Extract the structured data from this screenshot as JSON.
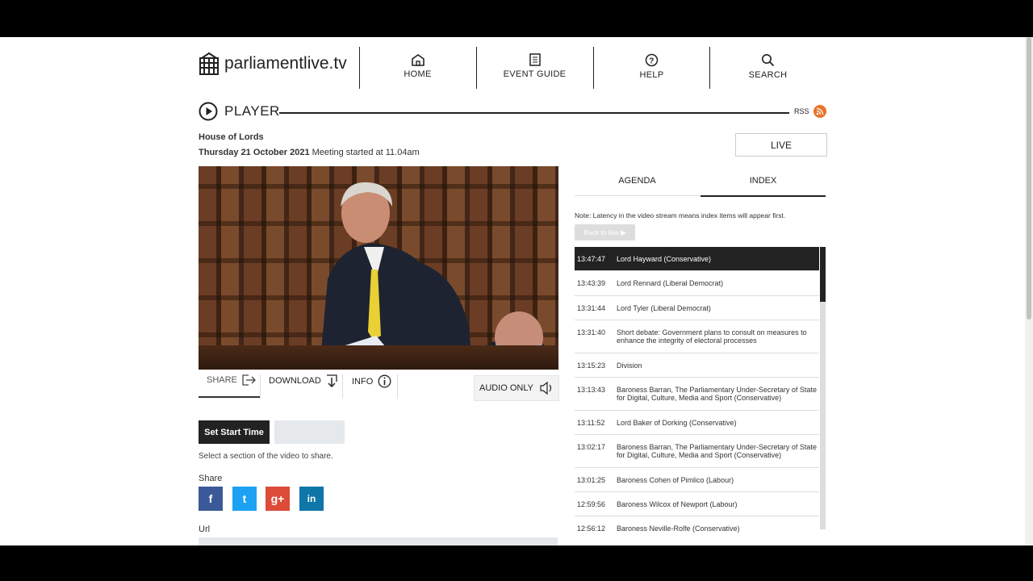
{
  "header": {
    "logo_text": "parliamentlive.tv",
    "nav": [
      {
        "label": "HOME",
        "icon": "home-icon"
      },
      {
        "label": "EVENT GUIDE",
        "icon": "document-icon"
      },
      {
        "label": "HELP",
        "icon": "help-icon"
      },
      {
        "label": "SEARCH",
        "icon": "search-icon"
      }
    ]
  },
  "player": {
    "title": "PLAYER",
    "rss_label": "RSS",
    "house": "House of Lords",
    "date": "Thursday 21 October 2021",
    "meeting_text": " Meeting started at 11.04am",
    "live_label": "LIVE"
  },
  "controls": {
    "share": "SHARE",
    "download": "DOWNLOAD",
    "info": "INFO",
    "audio_only": "AUDIO ONLY"
  },
  "share_panel": {
    "set_start_label": "Set Start Time",
    "hint": "Select a section of the video to share.",
    "share_label": "Share",
    "social": [
      {
        "name": "facebook",
        "glyph": "f",
        "color": "#3b5998"
      },
      {
        "name": "twitter",
        "glyph": "t",
        "color": "#1da1f2"
      },
      {
        "name": "google-plus",
        "glyph": "g+",
        "color": "#dd4b39"
      },
      {
        "name": "linkedin",
        "glyph": "in",
        "color": "#0e76a8"
      }
    ],
    "url_label": "Url"
  },
  "tabs": {
    "agenda": "AGENDA",
    "index": "INDEX"
  },
  "index": {
    "note": "Note: Latency in the video stream means index items will appear first.",
    "back_to_live": "Back to live ▶",
    "items": [
      {
        "time": "13:47:47",
        "text": "Lord Hayward (Conservative)",
        "active": true
      },
      {
        "time": "13:43:39",
        "text": "Lord Rennard (Liberal Democrat)"
      },
      {
        "time": "13:31:44",
        "text": "Lord Tyler (Liberal Democrat)"
      },
      {
        "time": "13:31:40",
        "text": "Short debate: Government plans to consult on measures to enhance the integrity of electoral processes"
      },
      {
        "time": "13:15:23",
        "text": "Division"
      },
      {
        "time": "13:13:43",
        "text": "Baroness Barran, The Parliamentary Under-Secretary of State for Digital, Culture, Media and Sport (Conservative)"
      },
      {
        "time": "13:11:52",
        "text": "Lord Baker of Dorking (Conservative)"
      },
      {
        "time": "13:02:17",
        "text": "Baroness Barran, The Parliamentary Under-Secretary of State for Digital, Culture, Media and Sport (Conservative)"
      },
      {
        "time": "13:01:25",
        "text": "Baroness Cohen of Pimlico (Labour)"
      },
      {
        "time": "12:59:56",
        "text": "Baroness Wilcox of Newport (Labour)"
      },
      {
        "time": "12:56:12",
        "text": "Baroness Neville-Rolfe (Conservative)"
      }
    ]
  },
  "colors": {
    "accent_dark": "#222222",
    "rss": "#e8742b"
  }
}
